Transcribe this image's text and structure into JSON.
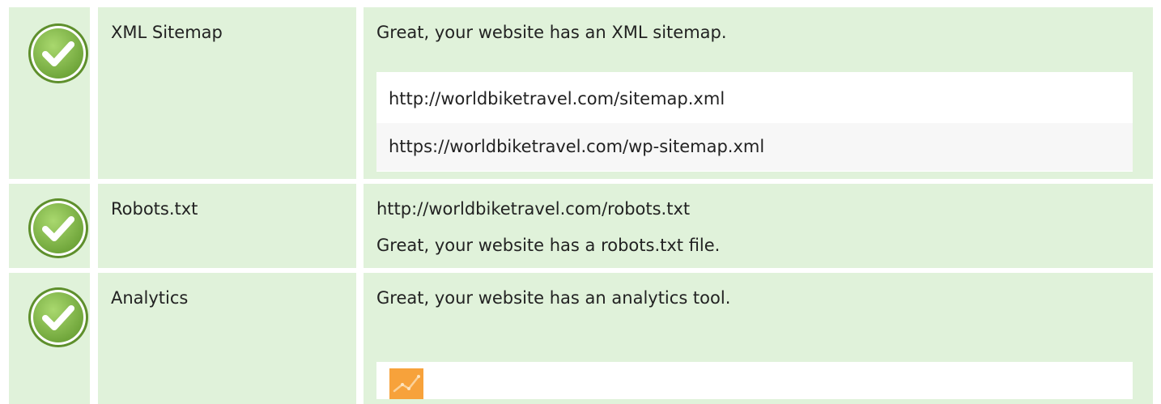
{
  "rows": [
    {
      "label": "XML Sitemap",
      "message": "Great, your website has an XML sitemap.",
      "urls": [
        "http://worldbiketravel.com/sitemap.xml",
        "https://worldbiketravel.com/wp-sitemap.xml"
      ],
      "status_icon": "check-circle-icon"
    },
    {
      "label": "Robots.txt",
      "url": "http://worldbiketravel.com/robots.txt",
      "message": "Great, your website has a robots.txt file.",
      "status_icon": "check-circle-icon"
    },
    {
      "label": "Analytics",
      "message": "Great, your website has an analytics tool.",
      "tool_icon": "google-analytics-icon",
      "status_icon": "check-circle-icon"
    }
  ],
  "colors": {
    "row_background": "#e0f2da",
    "check_green": "#8cc152",
    "analytics_orange": "#f7a23b"
  }
}
